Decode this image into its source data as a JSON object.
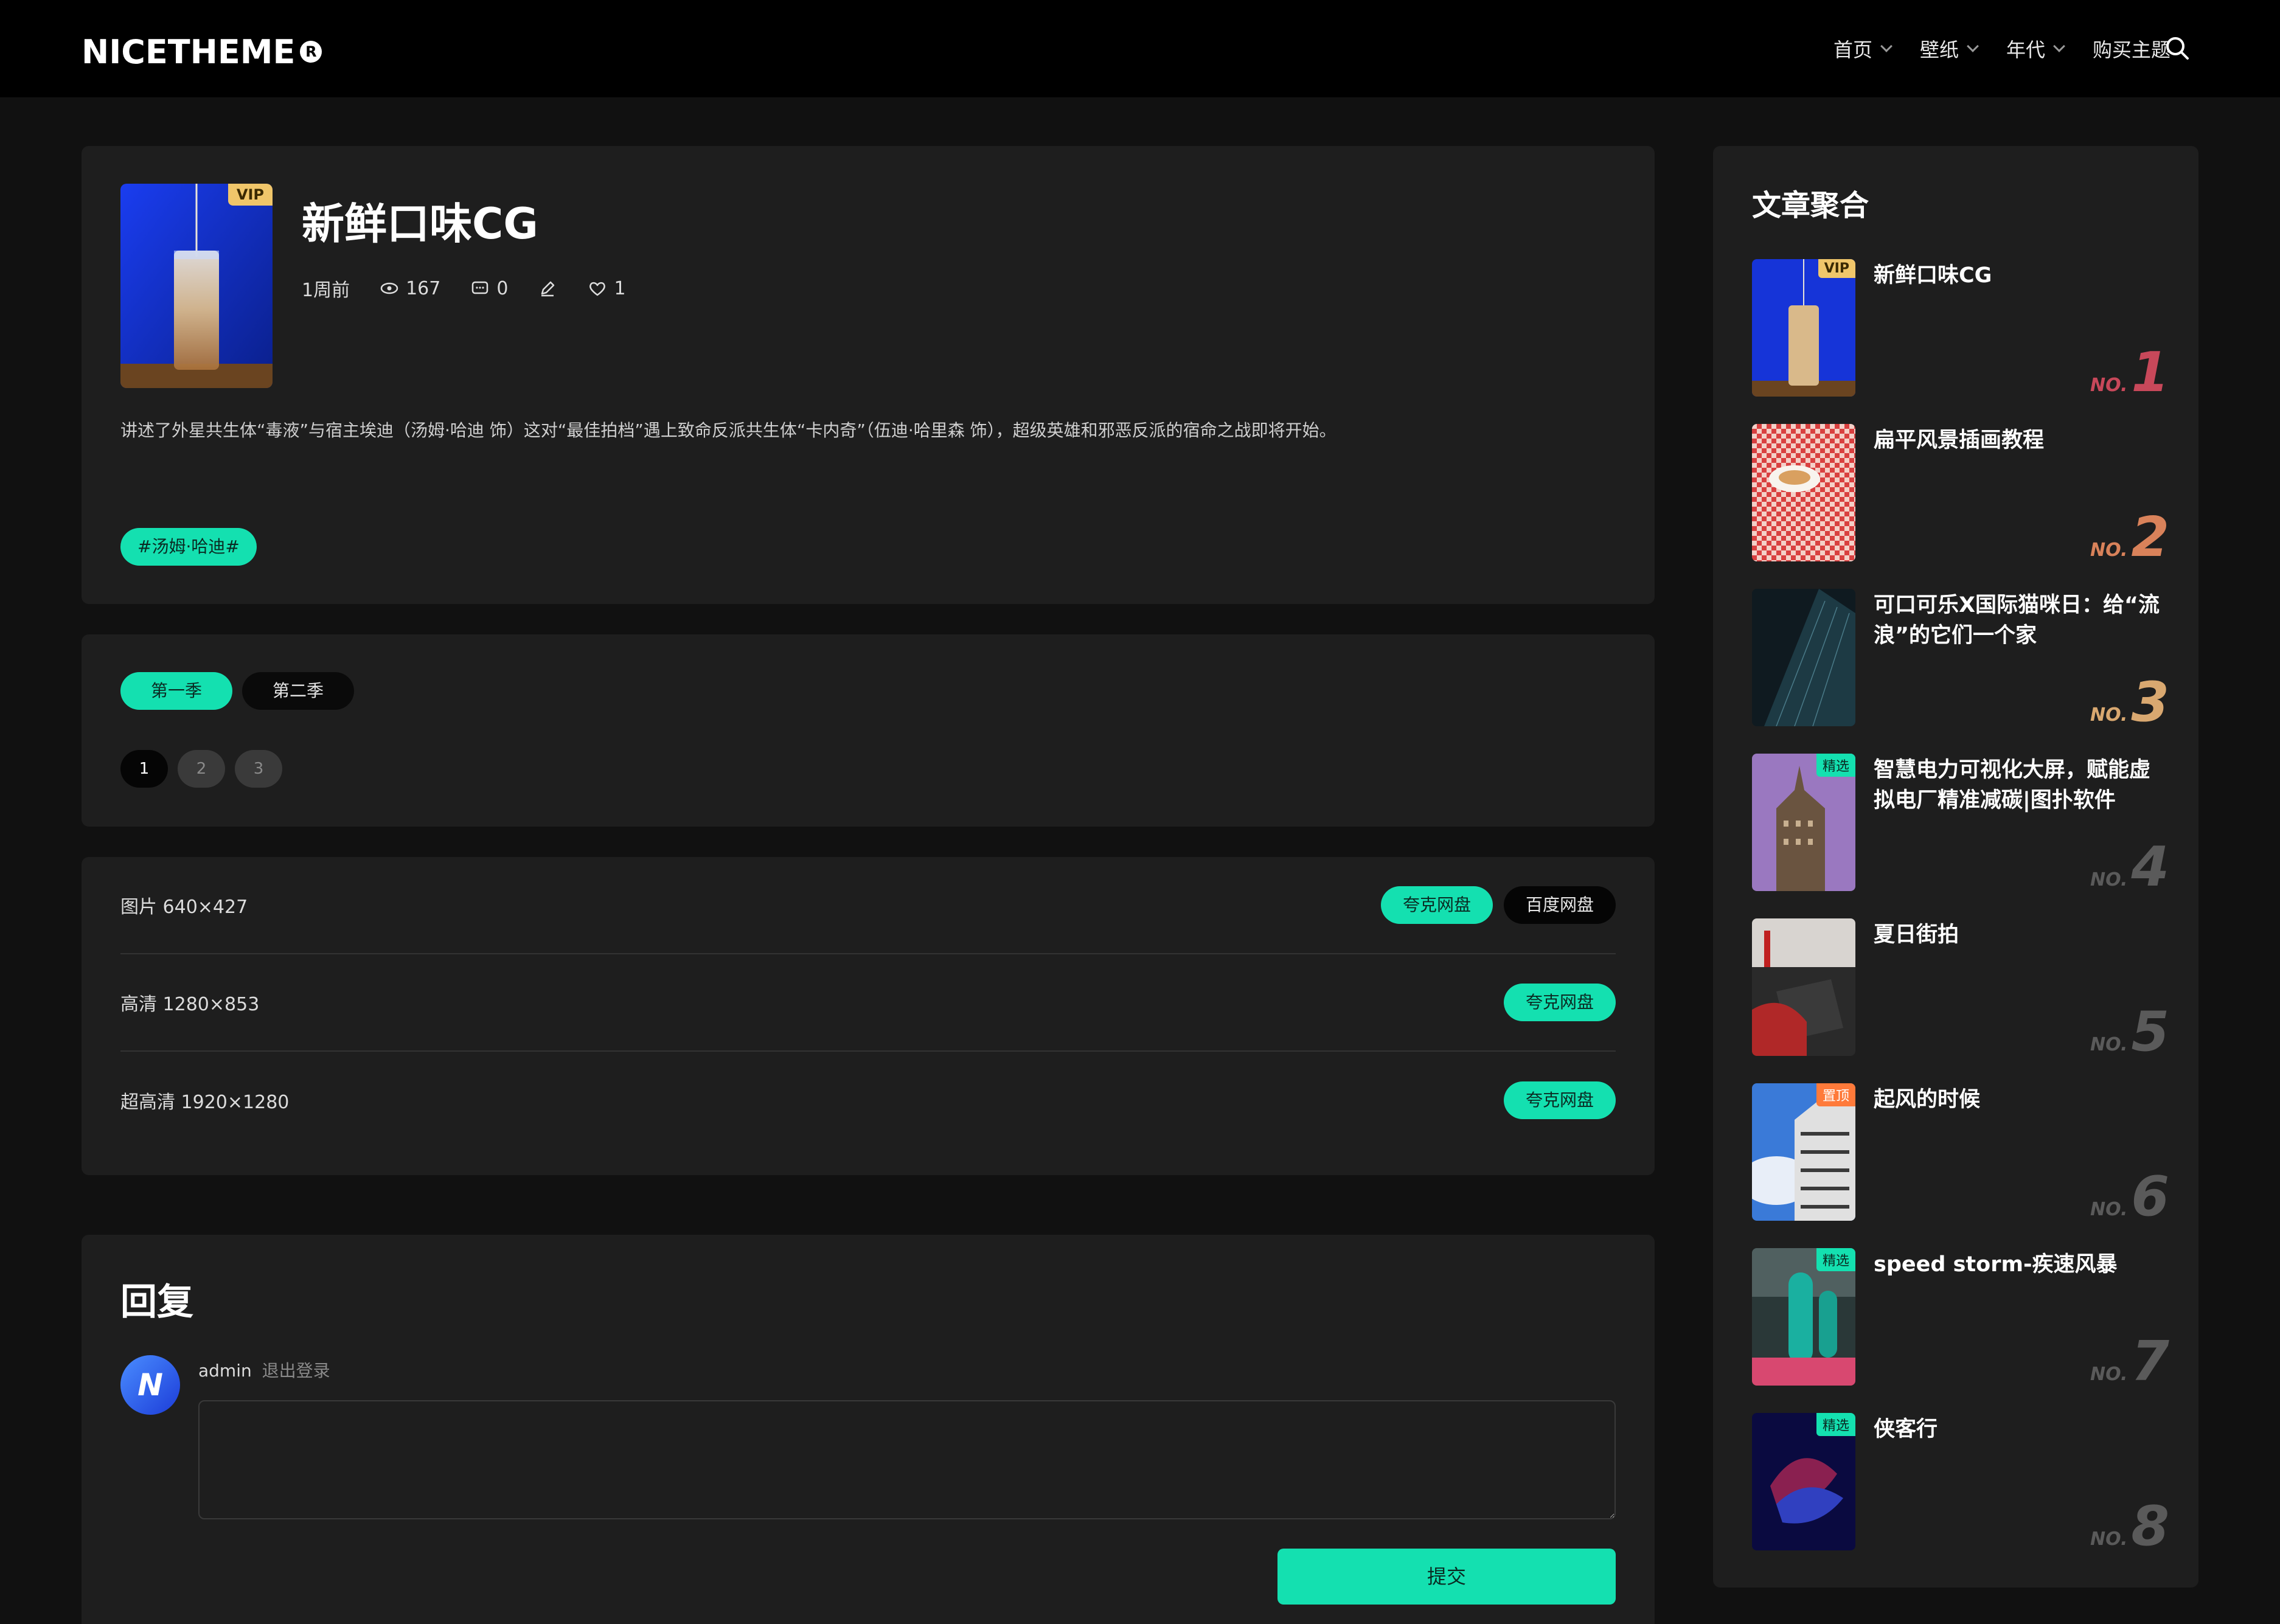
{
  "header": {
    "logo_text": "NICETHEME",
    "logo_mark": "R",
    "nav": [
      {
        "label": "首页",
        "has_dropdown": true
      },
      {
        "label": "壁纸",
        "has_dropdown": true
      },
      {
        "label": "年代",
        "has_dropdown": true
      },
      {
        "label": "购买主题",
        "has_dropdown": false
      }
    ],
    "search_icon": "search-icon"
  },
  "post": {
    "badge": "VIP",
    "title": "新鲜口味CG",
    "time": "1周前",
    "views": "167",
    "comments": "0",
    "likes": "1",
    "description": "讲述了外星共生体“毒液”与宿主埃迪（汤姆·哈迪 饰）这对“最佳拍档”遇上致命反派共生体“卡内奇”（伍迪·哈里森 饰），超级英雄和邪恶反派的宿命之战即将开始。",
    "tag": "#汤姆·哈迪#"
  },
  "seasons": {
    "tabs": [
      {
        "label": "第一季",
        "active": true
      },
      {
        "label": "第二季",
        "active": false
      }
    ],
    "pages": [
      "1",
      "2",
      "3"
    ],
    "current_page": "1"
  },
  "downloads": [
    {
      "label": "图片 640×427",
      "buttons": [
        {
          "label": "夸克网盘",
          "style": "green"
        },
        {
          "label": "百度网盘",
          "style": "black"
        }
      ]
    },
    {
      "label": "高清 1280×853",
      "buttons": [
        {
          "label": "夸克网盘",
          "style": "green"
        }
      ]
    },
    {
      "label": "超高清 1920×1280",
      "buttons": [
        {
          "label": "夸克网盘",
          "style": "green"
        }
      ]
    }
  ],
  "reply": {
    "title": "回复",
    "avatar_text": "N",
    "username": "admin",
    "logout": "退出登录",
    "submit": "提交"
  },
  "sidebar": {
    "title": "文章聚合",
    "no_label": "NO.",
    "items": [
      {
        "title": "新鲜口味CG",
        "badge": "VIP",
        "badge_type": "vip",
        "rank": "1",
        "rank_color": "#c8485a"
      },
      {
        "title": "扁平风景插画教程",
        "badge": "",
        "badge_type": "",
        "rank": "2",
        "rank_color": "#d9825a"
      },
      {
        "title": "可口可乐X国际猫咪日：给“流浪”的它们一个家",
        "badge": "",
        "badge_type": "",
        "rank": "3",
        "rank_color": "#d9a870"
      },
      {
        "title": "智慧电力可视化大屏，赋能虚拟电厂精准减碳|图扑软件",
        "badge": "精选",
        "badge_type": "pick",
        "rank": "4",
        "rank_color": "#5a5a5a"
      },
      {
        "title": "夏日街拍",
        "badge": "",
        "badge_type": "",
        "rank": "5",
        "rank_color": "#5a5a5a"
      },
      {
        "title": "起风的时候",
        "badge": "置顶",
        "badge_type": "top",
        "rank": "6",
        "rank_color": "#5a5a5a"
      },
      {
        "title": "speed storm-疾速风暴",
        "badge": "精选",
        "badge_type": "pick",
        "rank": "7",
        "rank_color": "#5a5a5a"
      },
      {
        "title": "侠客行",
        "badge": "精选",
        "badge_type": "pick",
        "rank": "8",
        "rank_color": "#5a5a5a"
      }
    ]
  },
  "colors": {
    "accent": "#14e0b0",
    "vip": "#f0c66a",
    "top_badge": "#ff7a3a",
    "background": "#111111",
    "card": "#1e1e1e"
  }
}
